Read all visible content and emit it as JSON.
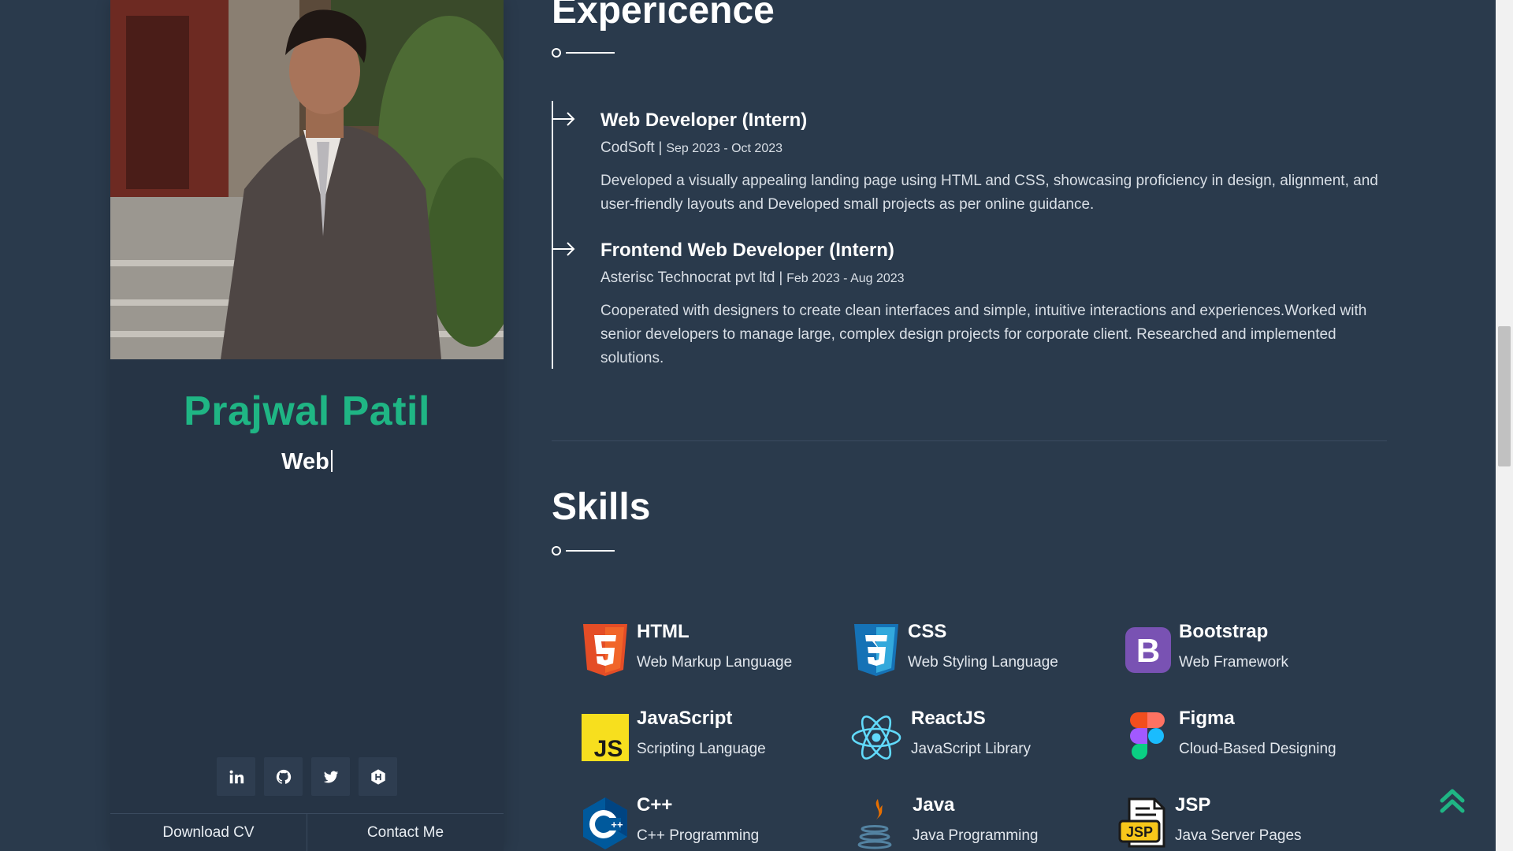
{
  "profile": {
    "name": "Prajwal Patil",
    "role_typed": "Web",
    "download_cv_label": "Download CV",
    "contact_label": "Contact Me",
    "social_icons": [
      "linkedin-icon",
      "github-icon",
      "twitter-icon",
      "hackerrank-icon"
    ]
  },
  "experience": {
    "heading": "Expericence",
    "items": [
      {
        "title": "Web Developer (Intern)",
        "company": "CodSoft",
        "dates": "Sep 2023 - Oct 2023",
        "description": "Developed a visually appealing landing page using HTML and CSS, showcasing proficiency in design, alignment, and user-friendly layouts and Developed small projects as per online guidance."
      },
      {
        "title": "Frontend Web Developer (Intern)",
        "company": "Asterisc Technocrat pvt ltd",
        "dates": "Feb 2023 - Aug 2023",
        "description": "Cooperated with designers to create clean interfaces and simple, intuitive interactions and experiences.Worked with senior developers to manage large, complex design projects for corporate client. Researched and implemented solutions."
      }
    ]
  },
  "skills": {
    "heading": "Skills",
    "items": [
      {
        "name": "HTML",
        "desc": "Web Markup Language",
        "icon": "html5-icon"
      },
      {
        "name": "CSS",
        "desc": "Web Styling Language",
        "icon": "css3-icon"
      },
      {
        "name": "Bootstrap",
        "desc": "Web Framework",
        "icon": "bootstrap-icon"
      },
      {
        "name": "JavaScript",
        "desc": "Scripting Language",
        "icon": "javascript-icon"
      },
      {
        "name": "ReactJS",
        "desc": "JavaScript Library",
        "icon": "react-icon"
      },
      {
        "name": "Figma",
        "desc": "Cloud-Based Designing",
        "icon": "figma-icon"
      },
      {
        "name": "C++",
        "desc": "C++ Programming",
        "icon": "cpp-icon"
      },
      {
        "name": "Java",
        "desc": "Java Programming",
        "icon": "java-icon"
      },
      {
        "name": "JSP",
        "desc": "Java Server Pages",
        "icon": "jsp-icon"
      }
    ]
  },
  "colors": {
    "background": "#2a3a4c",
    "card": "#263445",
    "accent_green": "#1fb584"
  }
}
